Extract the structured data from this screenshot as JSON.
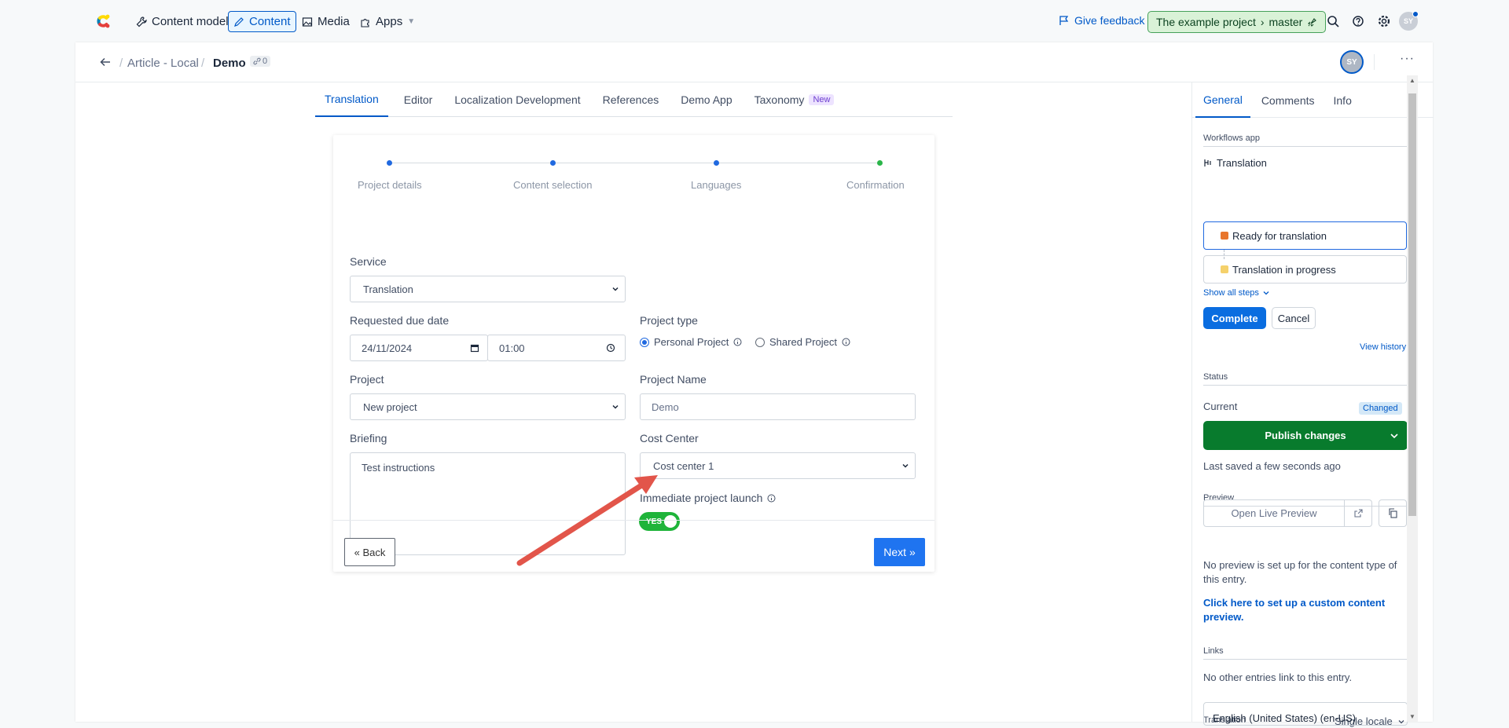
{
  "topnav": {
    "items": [
      "Content model",
      "Content",
      "Media",
      "Apps"
    ],
    "feedback": "Give feedback",
    "project": "The example project",
    "env": "master",
    "avatar": "SY"
  },
  "entry": {
    "breadcrumb": [
      "Article - Local",
      "Demo"
    ],
    "ref_count": "0",
    "avatar": "SY",
    "more": "···"
  },
  "tabs": [
    "Translation",
    "Editor",
    "Localization Development",
    "References",
    "Demo App",
    "Taxonomy"
  ],
  "tab_badge": "New",
  "form": {
    "steps": [
      "Project details",
      "Content selection",
      "Languages",
      "Confirmation"
    ],
    "service_label": "Service",
    "service_value": "Translation",
    "due_label": "Requested due date",
    "due_date": "24/11/2024",
    "due_time": "01:00",
    "project_type_label": "Project type",
    "project_type_options": [
      "Personal Project",
      "Shared Project"
    ],
    "project_label": "Project",
    "project_value": "New project",
    "project_name_label": "Project Name",
    "project_name_value": "Demo",
    "briefing_label": "Briefing",
    "briefing_value": "Test instructions",
    "cost_center_label": "Cost Center",
    "cost_center_value": "Cost center 1",
    "launch_label": "Immediate project launch",
    "launch_toggle": "YES",
    "back": "« Back",
    "next": "Next »"
  },
  "sidebar": {
    "tabs": [
      "General",
      "Comments",
      "Info"
    ],
    "workflows_title": "Workflows app",
    "workflow_name": "Translation",
    "workflow_steps": [
      "Ready for translation",
      "Translation in progress"
    ],
    "show_all": "Show all steps",
    "complete": "Complete",
    "cancel": "Cancel",
    "view_history": "View history",
    "status_title": "Status",
    "current": "Current",
    "changed": "Changed",
    "publish": "Publish changes",
    "last_saved": "Last saved a few seconds ago",
    "preview_title": "Preview",
    "open_preview": "Open Live Preview",
    "no_preview": "No preview is set up for the content type of this entry.",
    "setup_link": "Click here to set up a custom content preview.",
    "links_title": "Links",
    "no_links": "No other entries link to this entry.",
    "translation_title": "Translation",
    "locale_mode": "Single locale",
    "locale_value": "English (United States) (en-US)"
  },
  "colors": {
    "accent": "#0059c8",
    "publish": "#087b2d",
    "toggle": "#1fb43a",
    "step_done": "#2ab549"
  }
}
